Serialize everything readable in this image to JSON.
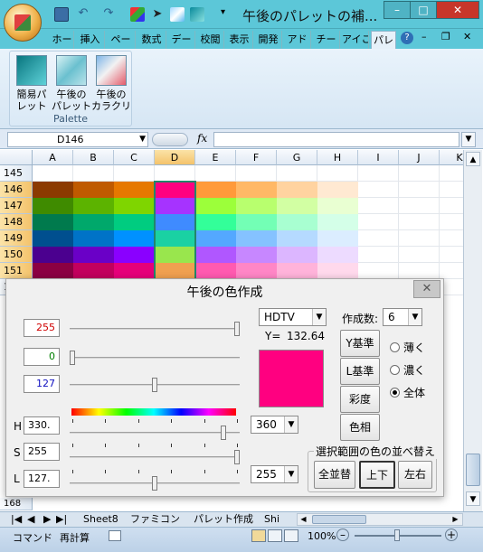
{
  "window": {
    "title": "午後のパレットの補...",
    "minimize": "–",
    "maximize": "□",
    "close": "✕"
  },
  "ribbon_tabs": [
    "ホー",
    "挿入",
    "ペー",
    "数式",
    "デー",
    "校閲",
    "表示",
    "開発",
    "アド",
    "チー",
    "アイこ",
    "パレ"
  ],
  "ribbon": {
    "group_label": "Palette",
    "buttons": [
      {
        "label": "簡易パレット",
        "line1": "簡易パ",
        "line2": "レット"
      },
      {
        "label": "午後のパレット",
        "line1": "午後の",
        "line2": "パレット"
      },
      {
        "label": "午後のカラクリ",
        "line1": "午後の",
        "line2": "カラクリ"
      }
    ]
  },
  "formula_bar": {
    "name_box": "D146",
    "fx": "fx",
    "formula": ""
  },
  "grid": {
    "columns": [
      "A",
      "B",
      "C",
      "D",
      "E",
      "F",
      "G",
      "H",
      "I",
      "J",
      "K"
    ],
    "selected_column": "D",
    "rows": [
      "145",
      "146",
      "147",
      "148",
      "149",
      "150",
      "151",
      "152"
    ],
    "selected_rows": [
      "146",
      "147",
      "148",
      "149",
      "150",
      "151"
    ],
    "cell_colors": [
      [
        "#8b3a00",
        "#bf5a00",
        "#e67800",
        "#ff0080",
        "#ff9a3a",
        "#ffb866",
        "#ffd3a0",
        "#ffe9d2"
      ],
      [
        "#3f8b00",
        "#5cb300",
        "#7fd500",
        "#a633ff",
        "#9cff3a",
        "#b8ff6e",
        "#d2ffa3",
        "#e9ffd2"
      ],
      [
        "#007a4d",
        "#00a86b",
        "#00cc80",
        "#3f8bff",
        "#33ff99",
        "#73ffb5",
        "#a8ffd1",
        "#d4ffe8"
      ],
      [
        "#004f8f",
        "#0073c7",
        "#0091ff",
        "#1ad1a3",
        "#54a8ff",
        "#85c2ff",
        "#b5daff",
        "#dbedff"
      ],
      [
        "#4b008f",
        "#6a00c7",
        "#8a00ff",
        "#99e64d",
        "#b057ff",
        "#c787ff",
        "#dcb6ff",
        "#eddbff"
      ],
      [
        "#8b0043",
        "#c2005e",
        "#e6007a",
        "#f0a050",
        "#ff5ab0",
        "#ff86c6",
        "#ffb3da",
        "#ffd9ec"
      ]
    ],
    "hidden_row_label": "168"
  },
  "sheet_tabs": [
    "Sheet8",
    "ファミコン",
    "パレット作成",
    "Shi"
  ],
  "status": {
    "mode": "コマンド",
    "recalc": "再計算",
    "zoom": "100%"
  },
  "dialog": {
    "title": "午後の色作成",
    "close": "✕",
    "rgb": [
      {
        "value": "255",
        "color": "#d00000",
        "level": 1.0
      },
      {
        "value": "0",
        "color": "#008000",
        "level": 0.0
      },
      {
        "value": "127",
        "color": "#1010c0",
        "level": 0.5
      }
    ],
    "hsl": [
      {
        "label": "H",
        "value": "330.",
        "level": 0.92
      },
      {
        "label": "S",
        "value": "255",
        "level": 1.0
      },
      {
        "label": "L",
        "value": "127.",
        "level": 0.5
      }
    ],
    "standard": "HDTV",
    "y_label": "Y=",
    "y_value": "132.64",
    "preview_color": "#ff0080",
    "count_label": "作成数:",
    "count_value": "6",
    "buttons": {
      "y_base": "Y基準",
      "l_base": "L基準",
      "saturation": "彩度",
      "hue": "色相"
    },
    "radios": [
      {
        "label": "薄く",
        "checked": false
      },
      {
        "label": "濃く",
        "checked": false
      },
      {
        "label": "全体",
        "checked": true
      }
    ],
    "h_range": "360",
    "l_range": "255",
    "sort_group": {
      "title": "選択範囲の色の並べ替え",
      "all": "全並替",
      "up_down": "上下",
      "left_right": "左右"
    }
  }
}
